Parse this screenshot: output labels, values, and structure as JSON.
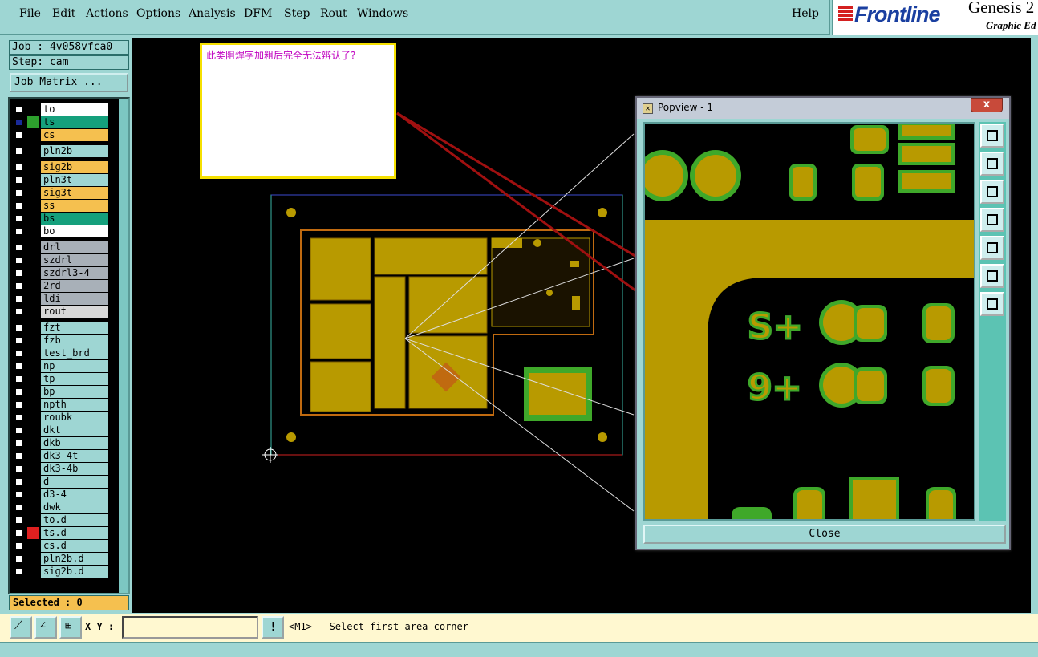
{
  "menu": [
    "File",
    "Edit",
    "Actions",
    "Options",
    "Analysis",
    "DFM",
    "Step",
    "Rout",
    "Windows"
  ],
  "help": "Help",
  "logo": {
    "brand": "Frontline",
    "product": "Genesis 2",
    "sub": "Graphic Ed"
  },
  "job": "Job : 4v058vfca0",
  "step": "Step: cam",
  "job_matrix": "Job Matrix ...",
  "layers": [
    {
      "name": "to",
      "color": "#ffffff",
      "check": "#ffffff",
      "swatch": "#000000"
    },
    {
      "name": "ts",
      "color": "#15a07c",
      "check": "#1a2a9a",
      "swatch": "#2da02d"
    },
    {
      "name": "cs",
      "color": "#f5c04f",
      "check": "#ffffff",
      "swatch": "#000000"
    },
    {
      "name": "pln2b",
      "color": "#9ed6d3",
      "check": "#ffffff",
      "swatch": "#000000"
    },
    {
      "name": "sig2b",
      "color": "#f5c04f",
      "check": "#ffffff",
      "swatch": "#000000"
    },
    {
      "name": "pln3t",
      "color": "#9ed6d3",
      "check": "#ffffff",
      "swatch": "#000000"
    },
    {
      "name": "sig3t",
      "color": "#f5c04f",
      "check": "#ffffff",
      "swatch": "#000000"
    },
    {
      "name": "ss",
      "color": "#f5c04f",
      "check": "#ffffff",
      "swatch": "#000000"
    },
    {
      "name": "bs",
      "color": "#15a07c",
      "check": "#ffffff",
      "swatch": "#000000"
    },
    {
      "name": "bo",
      "color": "#ffffff",
      "check": "#ffffff",
      "swatch": "#000000"
    },
    {
      "name": "drl",
      "color": "#a8b0b8",
      "check": "#ffffff",
      "swatch": "#000000"
    },
    {
      "name": "szdrl",
      "color": "#a8b0b8",
      "check": "#ffffff",
      "swatch": "#000000"
    },
    {
      "name": "szdrl3-4",
      "color": "#a8b0b8",
      "check": "#ffffff",
      "swatch": "#000000"
    },
    {
      "name": "2rd",
      "color": "#a8b0b8",
      "check": "#ffffff",
      "swatch": "#000000"
    },
    {
      "name": "ldi",
      "color": "#a8b0b8",
      "check": "#ffffff",
      "swatch": "#000000"
    },
    {
      "name": "rout",
      "color": "#d8d8d8",
      "check": "#ffffff",
      "swatch": "#000000"
    },
    {
      "name": "fzt",
      "color": "#9ed6d3",
      "check": "#ffffff",
      "swatch": "#000000"
    },
    {
      "name": "fzb",
      "color": "#9ed6d3",
      "check": "#ffffff",
      "swatch": "#000000"
    },
    {
      "name": "test_brd",
      "color": "#9ed6d3",
      "check": "#ffffff",
      "swatch": "#000000"
    },
    {
      "name": "np",
      "color": "#9ed6d3",
      "check": "#ffffff",
      "swatch": "#000000"
    },
    {
      "name": "tp",
      "color": "#9ed6d3",
      "check": "#ffffff",
      "swatch": "#000000"
    },
    {
      "name": "bp",
      "color": "#9ed6d3",
      "check": "#ffffff",
      "swatch": "#000000"
    },
    {
      "name": "npth",
      "color": "#9ed6d3",
      "check": "#ffffff",
      "swatch": "#000000"
    },
    {
      "name": "roubk",
      "color": "#9ed6d3",
      "check": "#ffffff",
      "swatch": "#000000"
    },
    {
      "name": "dkt",
      "color": "#9ed6d3",
      "check": "#ffffff",
      "swatch": "#000000"
    },
    {
      "name": "dkb",
      "color": "#9ed6d3",
      "check": "#ffffff",
      "swatch": "#000000"
    },
    {
      "name": "dk3-4t",
      "color": "#9ed6d3",
      "check": "#ffffff",
      "swatch": "#000000"
    },
    {
      "name": "dk3-4b",
      "color": "#9ed6d3",
      "check": "#ffffff",
      "swatch": "#000000"
    },
    {
      "name": "d",
      "color": "#9ed6d3",
      "check": "#ffffff",
      "swatch": "#000000"
    },
    {
      "name": "d3-4",
      "color": "#9ed6d3",
      "check": "#ffffff",
      "swatch": "#000000"
    },
    {
      "name": "dwk",
      "color": "#9ed6d3",
      "check": "#ffffff",
      "swatch": "#000000"
    },
    {
      "name": "to.d",
      "color": "#9ed6d3",
      "check": "#ffffff",
      "swatch": "#000000"
    },
    {
      "name": "ts.d",
      "color": "#9ed6d3",
      "check": "#ffffff",
      "swatch": "#e02020"
    },
    {
      "name": "cs.d",
      "color": "#9ed6d3",
      "check": "#ffffff",
      "swatch": "#000000"
    },
    {
      "name": "pln2b.d",
      "color": "#9ed6d3",
      "check": "#ffffff",
      "swatch": "#000000"
    },
    {
      "name": "sig2b.d",
      "color": "#9ed6d3",
      "check": "#ffffff",
      "swatch": "#000000"
    }
  ],
  "selected": "Selected : 0",
  "note_text": "此类阻焊字加粗后完全无法辨认了?",
  "popview": {
    "title": "Popview - 1",
    "close_x": "x",
    "close_label": "Close"
  },
  "xy_label": "X Y :",
  "xy_value": "",
  "status": "<M1> - Select first area corner",
  "colors": {
    "copper": "#b89a00",
    "mask": "#3fa82a",
    "ui_teal": "#9ed6d3",
    "arrow": "#a01010"
  }
}
